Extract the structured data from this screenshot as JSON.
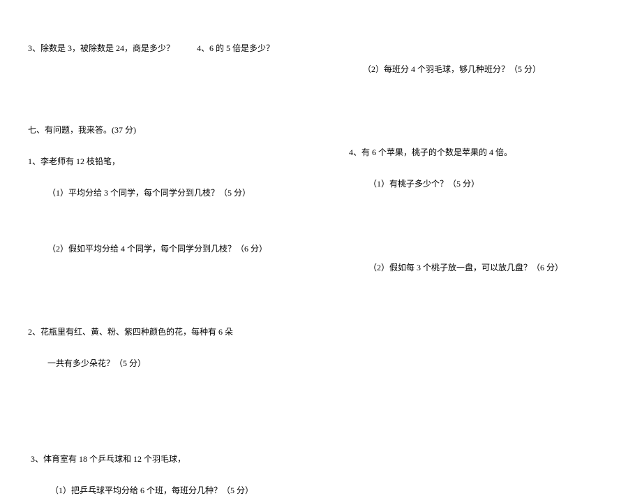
{
  "left": {
    "q3": "3、除数是 3，被除数是 24，商是多少？",
    "q4": "4、6 的 5 倍是多少？",
    "section7": "七、有问题，我来答。(37 分)",
    "q7_1": "1、李老师有 12 枝铅笔，",
    "q7_1_1": "（1）平均分给 3 个同学，每个同学分到几枝？（5 分）",
    "q7_1_2": "（2）假如平均分给 4 个同学，每个同学分到几枝？（6 分）",
    "q7_2": "2、花瓶里有红、黄、粉、紫四种颜色的花，每种有 6 朵",
    "q7_2_cont": "一共有多少朵花？（5 分）",
    "q7_3": "3、体育室有 18 个乒乓球和 12 个羽毛球，",
    "q7_3_1": "（1）把乒乓球平均分给 6 个班，每班分几种？（5 分）"
  },
  "right": {
    "q7_3_2": "（2）每班分 4 个羽毛球，够几种班分？（5 分）",
    "q7_4": "4、有 6 个苹果，桃子的个数是苹果的 4 倍。",
    "q7_4_1": "（1）有桃子多少个？（5 分）",
    "q7_4_2": "（2）假如每 3 个桃子放一盘，可以放几盘？（6 分）"
  }
}
